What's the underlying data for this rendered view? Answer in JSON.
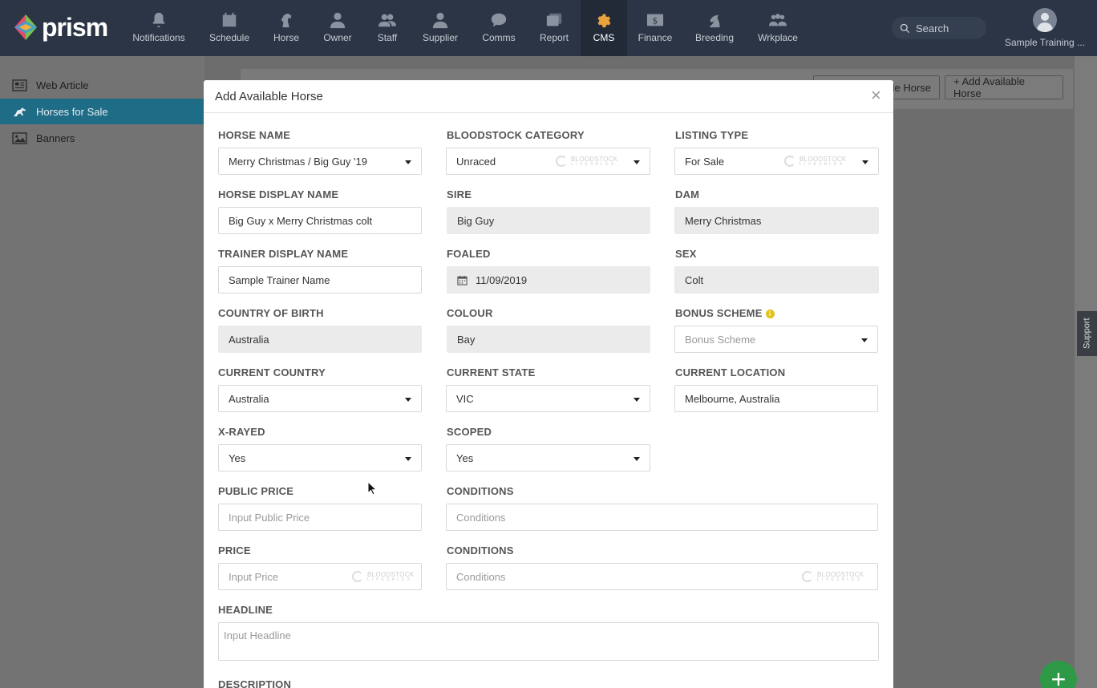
{
  "app": {
    "logo_text": "prism"
  },
  "nav": [
    {
      "label": "Notifications",
      "icon": "bell-icon"
    },
    {
      "label": "Schedule",
      "icon": "calendar-icon"
    },
    {
      "label": "Horse",
      "icon": "horse-icon"
    },
    {
      "label": "Owner",
      "icon": "person-icon"
    },
    {
      "label": "Staff",
      "icon": "people-icon"
    },
    {
      "label": "Supplier",
      "icon": "supplier-icon"
    },
    {
      "label": "Comms",
      "icon": "chat-icon"
    },
    {
      "label": "Report",
      "icon": "report-icon"
    },
    {
      "label": "CMS",
      "icon": "gear-icon",
      "active": true
    },
    {
      "label": "Finance",
      "icon": "dollar-icon"
    },
    {
      "label": "Breeding",
      "icon": "chess-knight-icon"
    },
    {
      "label": "Wrkplace",
      "icon": "team-icon"
    }
  ],
  "search": {
    "placeholder": "Search"
  },
  "user": {
    "name": "Sample Training ..."
  },
  "sidebar": {
    "items": [
      {
        "label": "Web Article",
        "icon": "newspaper-icon"
      },
      {
        "label": "Horses for Sale",
        "icon": "racehorse-icon",
        "active": true
      },
      {
        "label": "Banners",
        "icon": "image-icon"
      }
    ]
  },
  "background": {
    "btn_partial": "ble Horse",
    "btn_add": "+ Add Available Horse",
    "support": "Support",
    "fab": "+"
  },
  "modal": {
    "title": "Add Available Horse",
    "close": "×",
    "watermark": {
      "name": "BLOODSTOCK",
      "sub": "L I V E  S A L E S"
    },
    "fields": {
      "horse_name": {
        "label": "HORSE NAME",
        "value": "Merry Christmas / Big Guy '19"
      },
      "bloodstock_category": {
        "label": "BLOODSTOCK CATEGORY",
        "value": "Unraced"
      },
      "listing_type": {
        "label": "LISTING TYPE",
        "value": "For Sale"
      },
      "horse_display_name": {
        "label": "HORSE DISPLAY NAME",
        "value": "Big Guy x Merry Christmas colt"
      },
      "sire": {
        "label": "SIRE",
        "value": "Big Guy"
      },
      "dam": {
        "label": "DAM",
        "value": "Merry Christmas"
      },
      "trainer_display_name": {
        "label": "TRAINER DISPLAY NAME",
        "value": "Sample Trainer Name"
      },
      "foaled": {
        "label": "FOALED",
        "value": "11/09/2019"
      },
      "sex": {
        "label": "SEX",
        "value": "Colt"
      },
      "country_of_birth": {
        "label": "COUNTRY OF BIRTH",
        "value": "Australia"
      },
      "colour": {
        "label": "COLOUR",
        "value": "Bay"
      },
      "bonus_scheme": {
        "label": "BONUS SCHEME",
        "placeholder": "Bonus Scheme"
      },
      "current_country": {
        "label": "CURRENT COUNTRY",
        "value": "Australia"
      },
      "current_state": {
        "label": "CURRENT STATE",
        "value": "VIC"
      },
      "current_location": {
        "label": "CURRENT LOCATION",
        "value": "Melbourne, Australia"
      },
      "x_rayed": {
        "label": "X-RAYED",
        "value": "Yes"
      },
      "scoped": {
        "label": "SCOPED",
        "value": "Yes"
      },
      "public_price": {
        "label": "PUBLIC PRICE",
        "placeholder": "Input Public Price"
      },
      "public_conditions": {
        "label": "CONDITIONS",
        "placeholder": "Conditions"
      },
      "price": {
        "label": "PRICE",
        "placeholder": "Input Price"
      },
      "price_conditions": {
        "label": "CONDITIONS",
        "placeholder": "Conditions"
      },
      "headline": {
        "label": "HEADLINE",
        "placeholder": "Input Headline"
      },
      "description": {
        "label": "DESCRIPTION"
      }
    }
  }
}
